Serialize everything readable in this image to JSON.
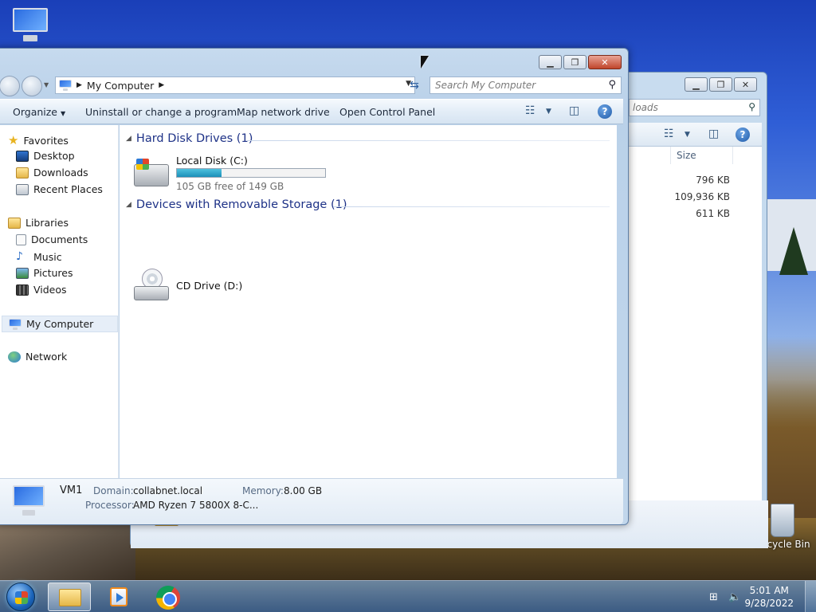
{
  "desktop": {
    "recycle_bin_label": "Recycle Bin"
  },
  "back_window": {
    "search_fragment": "loads",
    "column_header_size": "Size",
    "sizes": [
      "796 KB",
      "109,936 KB",
      "611 KB"
    ]
  },
  "front_window": {
    "breadcrumb": "My Computer",
    "search_placeholder": "Search My Computer",
    "commands": {
      "organize": "Organize",
      "uninstall": "Uninstall or change a program",
      "map_drive": "Map network drive",
      "control_panel": "Open Control Panel"
    },
    "nav": {
      "favorites": "Favorites",
      "desktop": "Desktop",
      "downloads": "Downloads",
      "recent_places": "Recent Places",
      "libraries": "Libraries",
      "documents": "Documents",
      "music": "Music",
      "pictures": "Pictures",
      "videos": "Videos",
      "my_computer": "My Computer",
      "network": "Network"
    },
    "groups": {
      "hard_disk": "Hard Disk Drives (1)",
      "removable": "Devices with Removable Storage (1)"
    },
    "drives": {
      "local_disk": {
        "label": "Local Disk (C:)",
        "free_text": "105 GB free of 149 GB",
        "used_fraction": 0.3
      },
      "cd_drive": {
        "label": "CD Drive (D:)"
      }
    },
    "details": {
      "computer_name": "VM1",
      "domain_label": "Domain:",
      "domain_value": "collabnet.local",
      "memory_label": "Memory:",
      "memory_value": "8.00 GB",
      "processor_label": "Processor:",
      "processor_value": "AMD Ryzen 7 5800X 8-C..."
    }
  },
  "taskbar": {
    "time": "5:01 AM",
    "date": "9/28/2022"
  },
  "colors": {
    "group_header": "#1e3287",
    "drive_bar_fill": "#1b8fb8"
  }
}
